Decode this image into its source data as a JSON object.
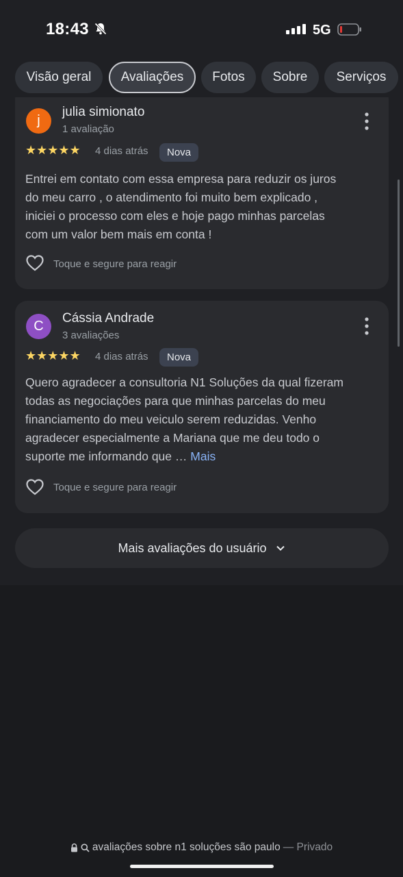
{
  "status_bar": {
    "time": "18:43",
    "network": "5G",
    "icons": [
      "bell-muted-icon",
      "signal-icon",
      "battery-low-icon"
    ]
  },
  "tabs": [
    {
      "label": "Visão geral",
      "active": false
    },
    {
      "label": "Avaliações",
      "active": true
    },
    {
      "label": "Fotos",
      "active": false
    },
    {
      "label": "Sobre",
      "active": false
    },
    {
      "label": "Serviços",
      "active": false
    }
  ],
  "reviews": [
    {
      "avatar_letter": "j",
      "avatar_color": "#f06a12",
      "name": "julia simionato",
      "review_count": "1 avaliação",
      "rating": 5,
      "stars": "★★★★★",
      "date": "4 dias atrás",
      "badge": "Nova",
      "text_lines": [
        "Entrei em contato com essa empresa para reduzir os juros",
        "do meu carro , o atendimento foi muito bem explicado ,",
        "iniciei o processo com eles e hoje pago minhas parcelas",
        "com um valor bem mais em conta !"
      ],
      "react_label": "Toque e segure para reagir"
    },
    {
      "avatar_letter": "C",
      "avatar_color": "#8e4fc4",
      "name": "Cássia Andrade",
      "review_count": "3 avaliações",
      "rating": 5,
      "stars": "★★★★★",
      "date": "4 dias atrás",
      "badge": "Nova",
      "text_lines": [
        "Quero agradecer a consultoria N1 Soluções da qual fizeram",
        "todas as negociações para que minhas parcelas do meu",
        "financiamento do meu veiculo serem reduzidas. Venho",
        "agradecer especialmente a Mariana que me deu todo o",
        "suporte me informando que …"
      ],
      "more_label": "Mais",
      "react_label": "Toque e segure para reagir"
    }
  ],
  "more_reviews_button": "Mais avaliações do usuário",
  "url_bar": {
    "query": "avaliações sobre n1 soluções são paulo",
    "mode": "— Privado"
  },
  "colors": {
    "background": "#1a1b1e",
    "card": "#2a2b2f",
    "star": "#fdd663",
    "link": "#8ab4f8",
    "battery_low": "#e53935"
  }
}
